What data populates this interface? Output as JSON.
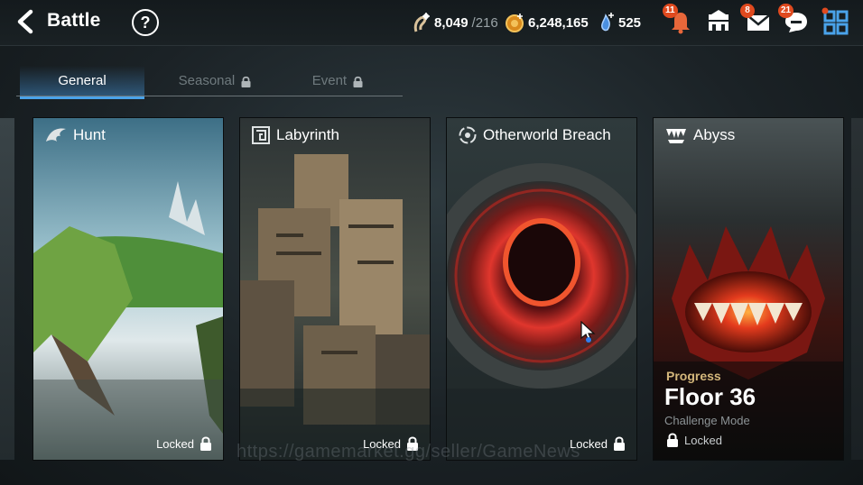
{
  "header": {
    "back_icon": "back-arrow-icon",
    "title": "Battle",
    "help_icon": "question-icon",
    "help_glyph": "?"
  },
  "currencies": [
    {
      "icon": "stamina-icon",
      "value": "8,049",
      "max": "/216"
    },
    {
      "icon": "gold-coin-icon",
      "value": "6,248,165"
    },
    {
      "icon": "crystal-icon",
      "value": "525"
    }
  ],
  "top_icons": [
    {
      "icon": "notification-bell-icon",
      "badge": "11"
    },
    {
      "icon": "guild-icon",
      "badge": ""
    },
    {
      "icon": "mail-icon",
      "badge": "8"
    },
    {
      "icon": "chat-icon",
      "badge": "21"
    },
    {
      "icon": "menu-grid-icon",
      "badge": ""
    }
  ],
  "tabs": [
    {
      "label": "General",
      "active": true,
      "locked": false
    },
    {
      "label": "Seasonal",
      "active": false,
      "locked": true
    },
    {
      "label": "Event",
      "active": false,
      "locked": true
    }
  ],
  "cards": [
    {
      "title": "Hunt",
      "icon": "dragon-icon",
      "status": "Locked"
    },
    {
      "title": "Labyrinth",
      "icon": "maze-icon",
      "status": "Locked"
    },
    {
      "title": "Otherworld Breach",
      "icon": "portal-icon",
      "status": "Locked"
    },
    {
      "title": "Abyss",
      "icon": "fangs-icon",
      "progress_label": "Progress",
      "progress_value": "Floor 36",
      "mode": "Challenge Mode",
      "status": "Locked"
    }
  ],
  "watermark": "https://gamemarket.gg/seller/GameNews",
  "colors": {
    "accent_tab": "#4aa3ea",
    "badge": "#e04a1f",
    "progress_gold": "#d4b77b"
  }
}
